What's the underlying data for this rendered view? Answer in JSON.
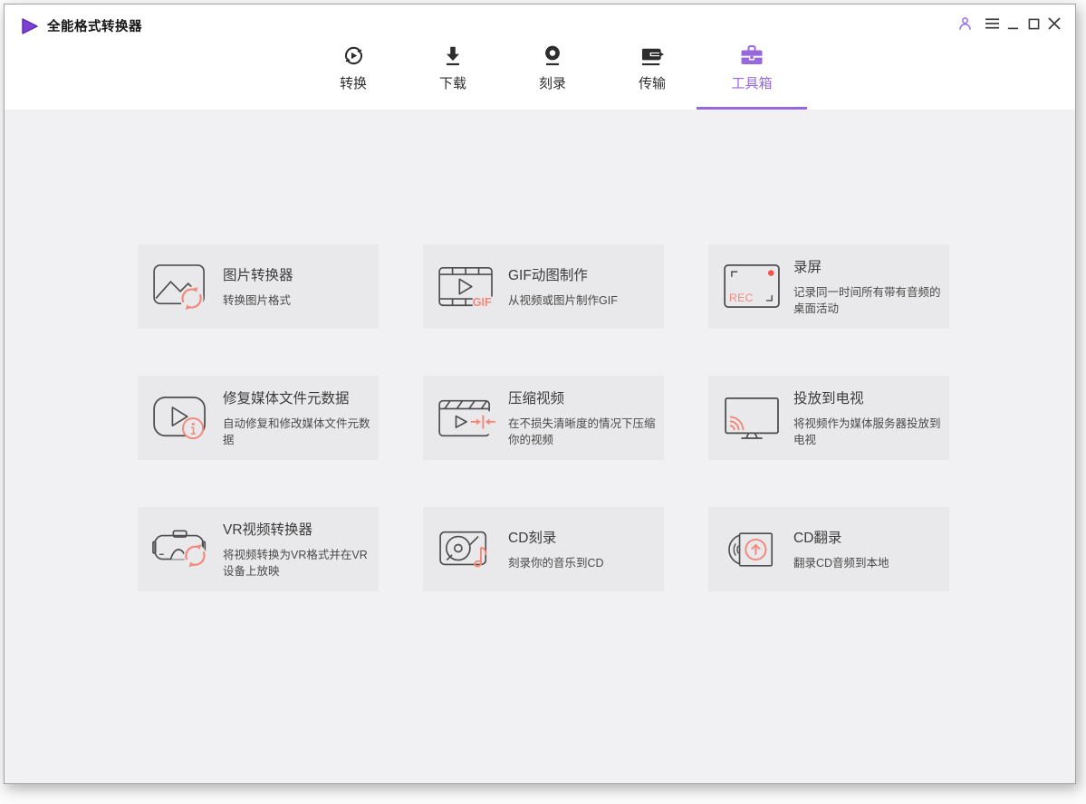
{
  "app": {
    "title": "全能格式转换器"
  },
  "titlebar": {
    "controls": [
      {
        "name": "account",
        "icon": "user-icon"
      },
      {
        "name": "menu",
        "icon": "hamburger-icon"
      },
      {
        "name": "minimize",
        "icon": "minimize-icon"
      },
      {
        "name": "maximize",
        "icon": "maximize-icon"
      },
      {
        "name": "close",
        "icon": "close-icon"
      }
    ]
  },
  "nav": {
    "tabs": [
      {
        "id": "convert",
        "label": "转换",
        "icon": "convert-icon",
        "active": false
      },
      {
        "id": "download",
        "label": "下载",
        "icon": "download-icon",
        "active": false
      },
      {
        "id": "burn",
        "label": "刻录",
        "icon": "burn-icon",
        "active": false
      },
      {
        "id": "transfer",
        "label": "传输",
        "icon": "transfer-icon",
        "active": false
      },
      {
        "id": "toolbox",
        "label": "工具箱",
        "icon": "toolbox-icon",
        "active": true
      }
    ]
  },
  "toolbox": {
    "cards": [
      {
        "id": "image-converter",
        "title": "图片转换器",
        "subtitle": "转换图片格式",
        "icon": "image-converter-icon"
      },
      {
        "id": "gif-maker",
        "title": "GIF动图制作",
        "subtitle": "从视频或图片制作GIF",
        "icon": "gif-maker-icon"
      },
      {
        "id": "screen-record",
        "title": "录屏",
        "subtitle": "记录同一时间所有带有音频的桌面活动",
        "icon": "screen-record-icon"
      },
      {
        "id": "fix-metadata",
        "title": "修复媒体文件元数据",
        "subtitle": "自动修复和修改媒体文件元数据",
        "icon": "fix-metadata-icon"
      },
      {
        "id": "compress-video",
        "title": "压缩视频",
        "subtitle": "在不损失清晰度的情况下压缩你的视频",
        "icon": "compress-video-icon"
      },
      {
        "id": "cast-to-tv",
        "title": "投放到电视",
        "subtitle": "将视频作为媒体服务器投放到电视",
        "icon": "cast-to-tv-icon"
      },
      {
        "id": "vr-converter",
        "title": "VR视频转换器",
        "subtitle": "将视频转换为VR格式并在VR设备上放映",
        "icon": "vr-converter-icon"
      },
      {
        "id": "cd-burn",
        "title": "CD刻录",
        "subtitle": "刻录你的音乐到CD",
        "icon": "cd-burn-icon"
      },
      {
        "id": "cd-rip",
        "title": "CD翻录",
        "subtitle": "翻录CD音频到本地",
        "icon": "cd-rip-icon"
      }
    ]
  },
  "colors": {
    "accent": "#9668dc",
    "logo_purple": "#7e41d6",
    "icon_dark": "#4c4c4c",
    "nav_icon_dark": "#2d2d2d",
    "icon_coral": "#f2897c",
    "record_red": "#f4544a",
    "card_bg": "#e9e8ea",
    "page_bg": "#f1f0f2"
  }
}
